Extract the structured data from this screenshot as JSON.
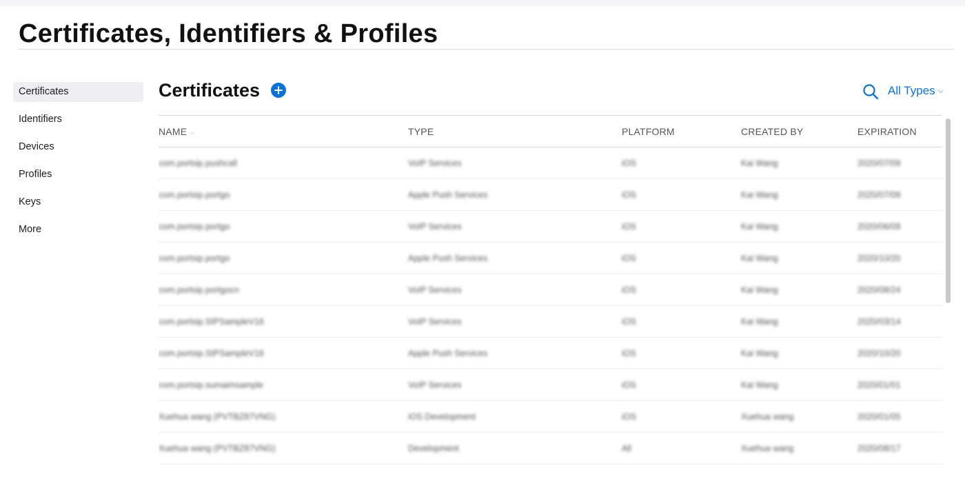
{
  "page": {
    "title": "Certificates, Identifiers & Profiles"
  },
  "sidebar": {
    "items": [
      {
        "label": "Certificates"
      },
      {
        "label": "Identifiers"
      },
      {
        "label": "Devices"
      },
      {
        "label": "Profiles"
      },
      {
        "label": "Keys"
      },
      {
        "label": "More"
      }
    ],
    "active": "Certificates"
  },
  "section": {
    "title": "Certificates",
    "add_icon": "plus-circle-icon"
  },
  "toolbar": {
    "search_icon": "search-icon",
    "filter_label": "All Types",
    "filter_chevron": "⌵"
  },
  "table": {
    "headers": {
      "name": "NAME",
      "type": "TYPE",
      "platform": "PLATFORM",
      "created_by": "CREATED BY",
      "expiration": "EXPIRATION"
    },
    "rows": [
      {
        "name": "com.portsip.pushcall",
        "type": "VoIP Services",
        "platform": "iOS",
        "created_by": "Kai Wang",
        "expiration": "2020/07/09"
      },
      {
        "name": "com.portsip.portgo",
        "type": "Apple Push Services",
        "platform": "iOS",
        "created_by": "Kai Wang",
        "expiration": "2020/07/09"
      },
      {
        "name": "com.portsip.portgo",
        "type": "VoIP Services",
        "platform": "iOS",
        "created_by": "Kai Wang",
        "expiration": "2020/06/09"
      },
      {
        "name": "com.portsip.portgo",
        "type": "Apple Push Services",
        "platform": "iOS",
        "created_by": "Kai Wang",
        "expiration": "2020/10/20"
      },
      {
        "name": "com.portsip.portgocn",
        "type": "VoIP Services",
        "platform": "iOS",
        "created_by": "Kai Wang",
        "expiration": "2020/08/24"
      },
      {
        "name": "com.portsip.SIPSampleV16",
        "type": "VoIP Services",
        "platform": "iOS",
        "created_by": "Kai Wang",
        "expiration": "2020/03/14"
      },
      {
        "name": "com.portsip.SIPSampleV16",
        "type": "Apple Push Services",
        "platform": "iOS",
        "created_by": "Kai Wang",
        "expiration": "2020/10/20"
      },
      {
        "name": "com.portsip.sumaimsample",
        "type": "VoIP Services",
        "platform": "iOS",
        "created_by": "Kai Wang",
        "expiration": "2020/01/01"
      },
      {
        "name": "Xuehua wang (PVTBZ87VNG)",
        "type": "iOS Development",
        "platform": "iOS",
        "created_by": "Xuehua wang",
        "expiration": "2020/01/05"
      },
      {
        "name": "Xuehua wang (PVTBZ87VNG)",
        "type": "Development",
        "platform": "All",
        "created_by": "Xuehua wang",
        "expiration": "2020/08/17"
      }
    ]
  }
}
